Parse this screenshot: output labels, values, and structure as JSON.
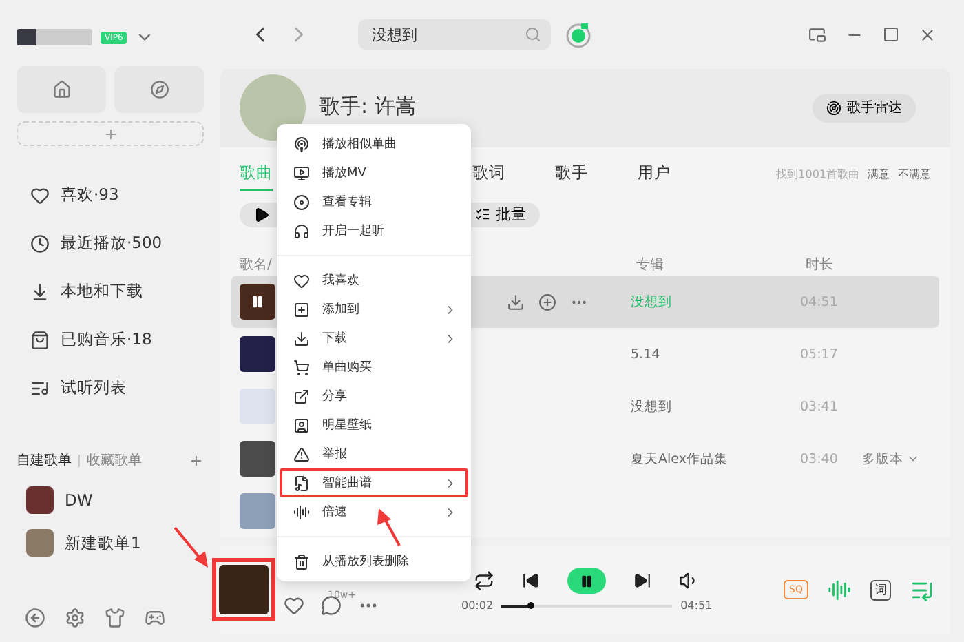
{
  "sidebar": {
    "vip_badge": "VIP6",
    "nav": [
      {
        "label": "喜欢·93"
      },
      {
        "label": "最近播放·500"
      },
      {
        "label": "本地和下载"
      },
      {
        "label": "已购音乐·18"
      },
      {
        "label": "试听列表"
      }
    ],
    "playlist_tabs": [
      {
        "label": "自建歌单",
        "selected": true
      },
      {
        "label": "收藏歌单",
        "selected": false
      }
    ],
    "playlists": [
      {
        "name": "DW"
      },
      {
        "name": "新建歌单1"
      }
    ]
  },
  "toolbar": {
    "search": {
      "value": "没想到"
    }
  },
  "artist": {
    "name": "歌手: 许嵩",
    "radar_button": "歌手雷达"
  },
  "tabs": [
    {
      "label": "歌曲",
      "selected": true
    },
    {
      "label": "歌词",
      "selected": false
    },
    {
      "label": "歌手",
      "selected": false
    },
    {
      "label": "用户",
      "selected": false
    }
  ],
  "result_info": {
    "count": "找到1001首歌曲",
    "feedback": [
      "满意",
      "不满意"
    ]
  },
  "batch_button": "批量",
  "columns": [
    "歌名/",
    "专辑",
    "时长"
  ],
  "rows": [
    {
      "album": "没想到",
      "duration": "04:51",
      "selected": true,
      "playing": true
    },
    {
      "album": "5.14",
      "duration": "05:17",
      "selected": false,
      "playing": false
    },
    {
      "album": "没想到",
      "duration": "03:41",
      "selected": false,
      "playing": false
    },
    {
      "album": "夏天Alex作品集",
      "duration": "03:40",
      "selected": false,
      "playing": false,
      "versions": "多版本"
    }
  ],
  "menu": {
    "items": [
      {
        "kind": "item",
        "label": "播放相似单曲",
        "submenu": false,
        "highlighted": false
      },
      {
        "kind": "item",
        "label": "播放MV",
        "submenu": false,
        "highlighted": false
      },
      {
        "kind": "item",
        "label": "查看专辑",
        "submenu": false,
        "highlighted": false
      },
      {
        "kind": "item",
        "label": "开启一起听",
        "submenu": false,
        "highlighted": false
      },
      {
        "kind": "divider"
      },
      {
        "kind": "item",
        "label": "我喜欢",
        "submenu": false,
        "highlighted": false
      },
      {
        "kind": "item",
        "label": "添加到",
        "submenu": true,
        "highlighted": false
      },
      {
        "kind": "item",
        "label": "下载",
        "submenu": true,
        "highlighted": false
      },
      {
        "kind": "item",
        "label": "单曲购买",
        "submenu": false,
        "highlighted": false
      },
      {
        "kind": "item",
        "label": "分享",
        "submenu": false,
        "highlighted": false
      },
      {
        "kind": "item",
        "label": "明星壁纸",
        "submenu": false,
        "highlighted": false
      },
      {
        "kind": "item",
        "label": "举报",
        "submenu": false,
        "highlighted": false
      },
      {
        "kind": "item",
        "label": "智能曲谱",
        "submenu": true,
        "highlighted": true
      },
      {
        "kind": "item",
        "label": "倍速",
        "submenu": true,
        "highlighted": false
      },
      {
        "kind": "divider"
      },
      {
        "kind": "item",
        "label": "从播放列表删除",
        "submenu": false,
        "highlighted": false
      }
    ]
  },
  "player": {
    "cover_highlighted": true,
    "comment_count": "10w+",
    "playing": true,
    "elapsed": "00:02",
    "level": 0.17,
    "total": "04:51",
    "quality": "SQ",
    "lyrics": "词"
  }
}
